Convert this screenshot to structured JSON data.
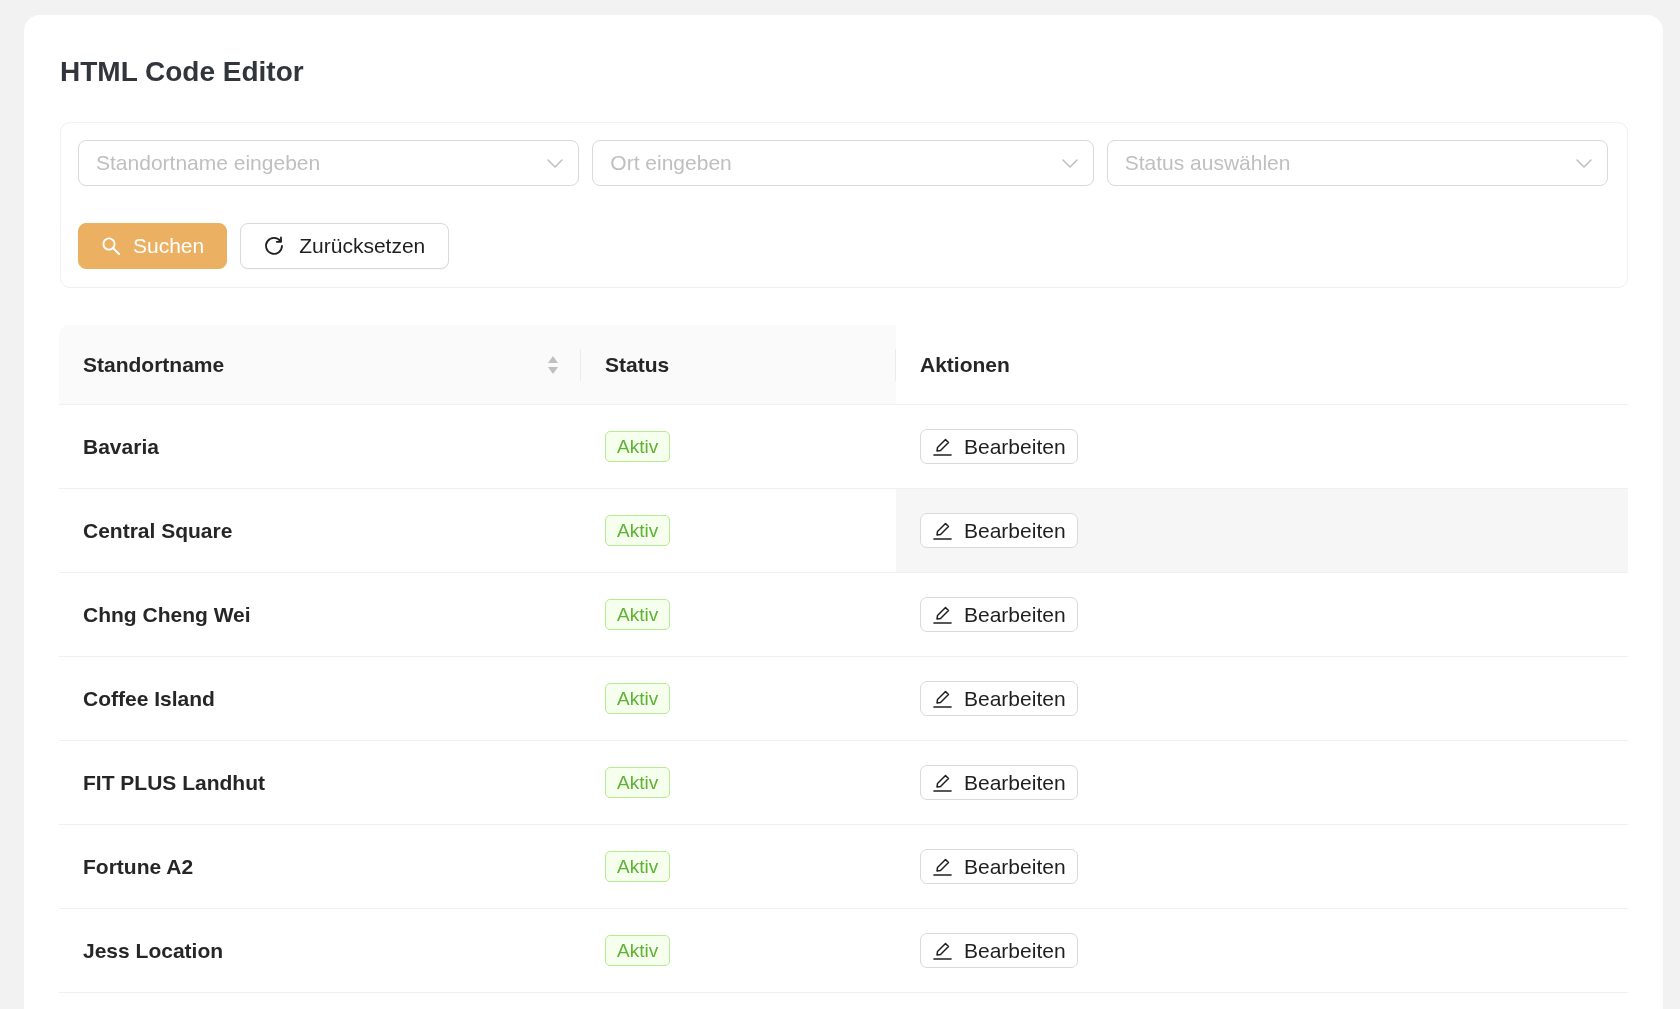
{
  "page": {
    "title": "HTML Code Editor"
  },
  "filters": {
    "fields": [
      {
        "placeholder": "Standortname eingeben"
      },
      {
        "placeholder": "Ort eingeben"
      },
      {
        "placeholder": "Status auswählen"
      }
    ],
    "buttons": [
      {
        "label": "Suchen",
        "kind": "primary"
      },
      {
        "label": "Zurücksetzen",
        "kind": "reset"
      }
    ]
  },
  "table": {
    "columns": [
      {
        "label": "Standortname",
        "sortable": true
      },
      {
        "label": "Status",
        "sortable": false
      },
      {
        "label": "Aktionen",
        "sortable": false
      }
    ],
    "rows": [
      {
        "name": "Bavaria",
        "status": "Aktiv",
        "action": "Bearbeiten",
        "hovered": false
      },
      {
        "name": "Central Square",
        "status": "Aktiv",
        "action": "Bearbeiten",
        "hovered": true
      },
      {
        "name": "Chng Cheng Wei",
        "status": "Aktiv",
        "action": "Bearbeiten",
        "hovered": false
      },
      {
        "name": "Coffee Island",
        "status": "Aktiv",
        "action": "Bearbeiten",
        "hovered": false
      },
      {
        "name": "FIT PLUS Landhut",
        "status": "Aktiv",
        "action": "Bearbeiten",
        "hovered": false
      },
      {
        "name": "Fortune A2",
        "status": "Aktiv",
        "action": "Bearbeiten",
        "hovered": false
      },
      {
        "name": "Jess Location",
        "status": "Aktiv",
        "action": "Bearbeiten",
        "hovered": false
      }
    ]
  }
}
